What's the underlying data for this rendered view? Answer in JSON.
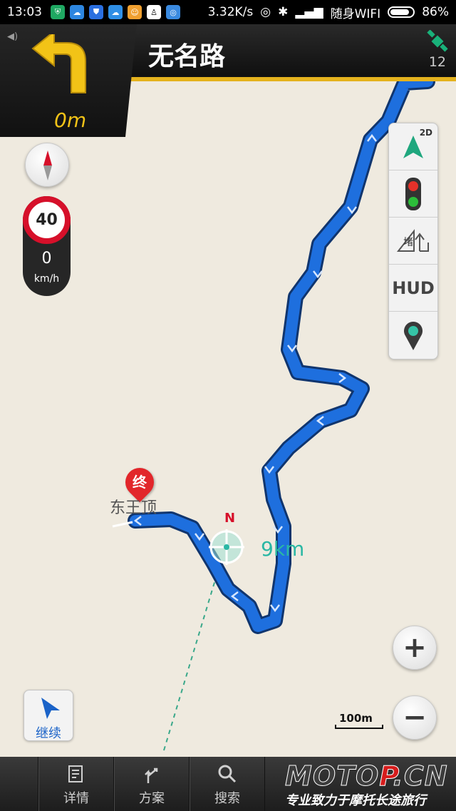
{
  "status_bar": {
    "time": "13:03",
    "net_speed": "3.32K/s",
    "network_label": "随身WIFI",
    "battery": "86%",
    "battery_level": 0.86,
    "left_icons": [
      "shield-icon",
      "cloud-app-icon",
      "shield-app-icon",
      "cloud-icon",
      "game-icon",
      "qq-icon",
      "app-icon"
    ]
  },
  "nav": {
    "road_name": "无名路",
    "distance": "0m",
    "turn_direction": "turn-left-icon",
    "satellite_count": "12"
  },
  "speed": {
    "limit": "40",
    "current": "0",
    "unit": "km/h"
  },
  "toolbar": {
    "view_mode": "2D",
    "hud_label": "HUD",
    "traffic_label": "堵"
  },
  "map": {
    "destination_badge": "终",
    "destination_name": "东王顶",
    "remaining": "9km",
    "north_label": "N",
    "scale": "100m"
  },
  "continue_button": {
    "label": "继续"
  },
  "bottom_bar": {
    "items": [
      {
        "label": "详情",
        "icon": "detail-icon"
      },
      {
        "label": "方案",
        "icon": "route-plan-icon"
      },
      {
        "label": "搜索",
        "icon": "search-icon"
      }
    ]
  },
  "watermark": {
    "brand": "MOTO",
    "brand_suffix": "P",
    "domain": ".CN",
    "slogan": "专业致力于摩托长途旅行"
  },
  "colors": {
    "route": "#1e6fde",
    "accent": "#e4b21d",
    "speed_ring": "#d6102a",
    "teal": "#2ab7a4"
  }
}
